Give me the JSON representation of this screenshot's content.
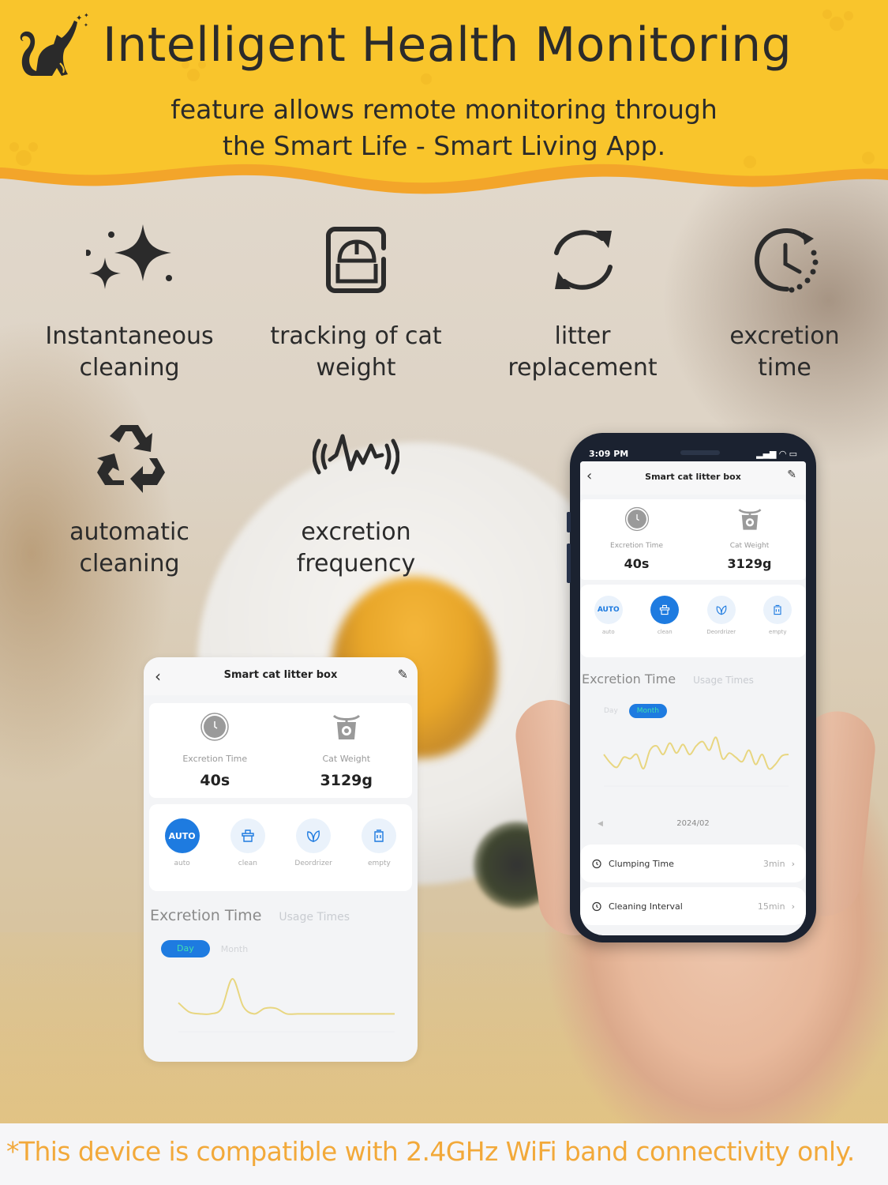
{
  "header": {
    "title": "Intelligent Health Monitoring",
    "subtitle_lines": [
      "feature allows remote monitoring through",
      "the Smart Life - Smart Living App."
    ]
  },
  "colors": {
    "banner_yellow": "#f9c52c",
    "banner_orange_wave": "#f3a52a",
    "text_dark": "#2b2b2b",
    "accent_blue": "#1e7be0",
    "chart_line": "#e8d680",
    "footer_orange": "#f2a93a"
  },
  "features": [
    {
      "icon": "sparkles-icon",
      "label_lines": [
        "Instantaneous",
        "cleaning"
      ]
    },
    {
      "icon": "weight-scale-icon",
      "label_lines": [
        "tracking of cat",
        "weight"
      ]
    },
    {
      "icon": "refresh-arrows-icon",
      "label_lines": [
        "litter",
        "replacement"
      ]
    },
    {
      "icon": "clock-timer-icon",
      "label_lines": [
        "excretion",
        "time"
      ]
    },
    {
      "icon": "recycle-icon",
      "label_lines": [
        "automatic",
        "cleaning"
      ]
    },
    {
      "icon": "waveform-icon",
      "label_lines": [
        "excretion",
        "frequency"
      ]
    }
  ],
  "card": {
    "back_icon": "chevron-left-icon",
    "title": "Smart cat litter box",
    "edit_icon": "pencil-icon",
    "stats": [
      {
        "icon": "clock-icon",
        "label": "Excretion Time",
        "value": "40s"
      },
      {
        "icon": "scale-icon",
        "label": "Cat Weight",
        "value": "3129g"
      }
    ],
    "actions": [
      {
        "icon": "auto-icon",
        "icon_text": "AUTO",
        "label": "auto",
        "active": true
      },
      {
        "icon": "brush-icon",
        "label": "clean",
        "active": false
      },
      {
        "icon": "leaf-icon",
        "label": "Deordrizer",
        "active": false
      },
      {
        "icon": "trash-icon",
        "label": "empty",
        "active": false
      }
    ],
    "chart_tabs": {
      "active": "Excretion Time",
      "inactive": "Usage Times"
    },
    "range_tabs": {
      "active": "Day",
      "inactive": "Month"
    }
  },
  "phone": {
    "status_time": "3:09 PM",
    "status_icons": "signal wifi battery",
    "title": "Smart cat litter box",
    "stats": [
      {
        "icon": "clock-icon",
        "label": "Excretion Time",
        "value": "40s"
      },
      {
        "icon": "scale-icon",
        "label": "Cat Weight",
        "value": "3129g"
      }
    ],
    "actions": [
      {
        "icon": "auto-icon",
        "icon_text": "AUTO",
        "label": "auto",
        "active": false
      },
      {
        "icon": "brush-icon",
        "label": "clean",
        "active": true
      },
      {
        "icon": "leaf-icon",
        "label": "Deordrizer",
        "active": false
      },
      {
        "icon": "trash-icon",
        "label": "empty",
        "active": false
      }
    ],
    "chart_tabs": {
      "active": "Excretion Time",
      "inactive": "Usage Times"
    },
    "range_tabs": {
      "inactive": "Day",
      "active": "Month"
    },
    "date": "2024/02",
    "settings": [
      {
        "icon": "timer-icon",
        "name": "Clumping Time",
        "value": "3min"
      },
      {
        "icon": "timer-icon",
        "name": "Cleaning Interval",
        "value": "15min"
      }
    ]
  },
  "chart_data": [
    {
      "type": "line",
      "title": "Excretion Time (Day)",
      "xlabel": "",
      "ylabel": "",
      "x": [
        0,
        1,
        2,
        3,
        4,
        5,
        6,
        7,
        8,
        9,
        10,
        11,
        12,
        13,
        14,
        15,
        16,
        17,
        18,
        19,
        20
      ],
      "values": [
        1.4,
        0.9,
        0.8,
        0.8,
        1.1,
        2.7,
        1.2,
        0.8,
        1.1,
        1.1,
        0.8,
        0.8,
        0.8,
        0.8,
        0.8,
        0.8,
        0.8,
        0.8,
        0.8,
        0.8,
        0.8
      ],
      "ylim": [
        0,
        3
      ],
      "grid": false
    },
    {
      "type": "line",
      "title": "Excretion Time (Month)",
      "xlabel": "",
      "ylabel": "",
      "x": [
        1,
        2,
        3,
        4,
        5,
        6,
        7,
        8,
        9,
        10,
        11,
        12,
        13,
        14,
        15,
        16,
        17,
        18,
        19,
        20,
        21,
        22,
        23,
        24,
        25,
        26,
        27,
        28,
        29
      ],
      "values": [
        2.0,
        1.4,
        1.1,
        1.8,
        1.7,
        2.0,
        1.0,
        2.3,
        2.6,
        2.0,
        2.8,
        2.1,
        2.7,
        2.0,
        2.6,
        2.9,
        2.3,
        3.2,
        1.7,
        2.1,
        1.8,
        1.5,
        2.3,
        1.3,
        2.0,
        1.0,
        1.3,
        1.9,
        2.0
      ],
      "ylim": [
        0,
        4
      ],
      "grid": false
    }
  ],
  "footer": {
    "note": "*This device is compatible with 2.4GHz WiFi band connectivity only."
  }
}
